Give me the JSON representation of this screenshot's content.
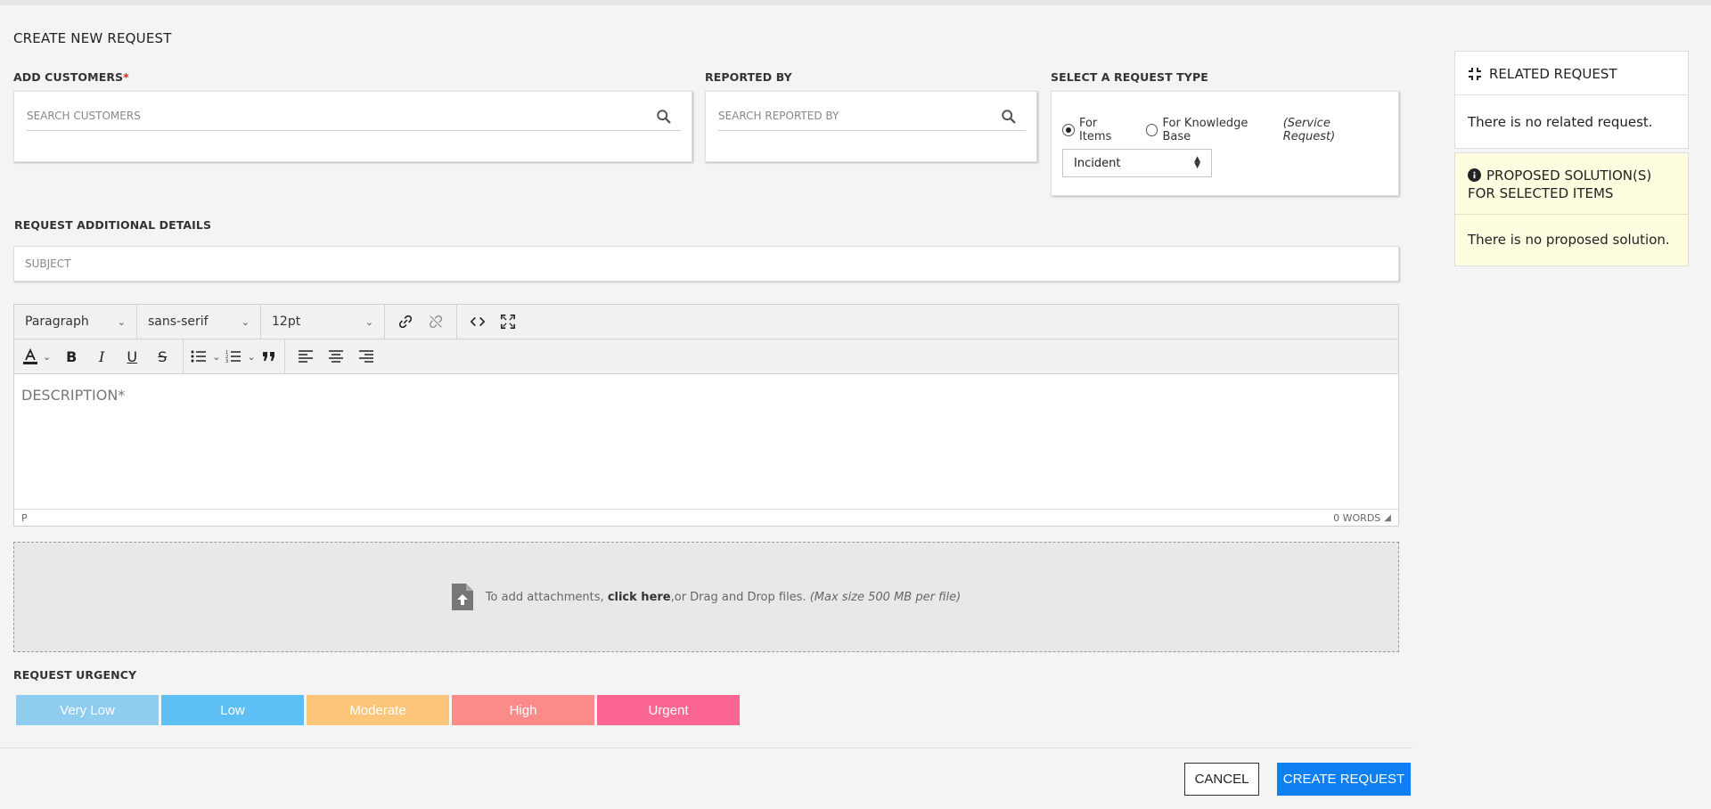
{
  "page": {
    "title": "CREATE NEW REQUEST"
  },
  "customers": {
    "label": "ADD CUSTOMERS",
    "required_mark": "*",
    "placeholder": "SEARCH CUSTOMERS"
  },
  "reported_by": {
    "label": "REPORTED BY",
    "placeholder": "SEARCH REPORTED BY"
  },
  "request_type": {
    "label": "SELECT A REQUEST TYPE",
    "option_items": "For Items",
    "option_kb": "For Knowledge Base",
    "option_kb_note": "(Service Request)",
    "selected_option": "For Items",
    "type_value": "Incident"
  },
  "details": {
    "label": "REQUEST ADDITIONAL DETAILS",
    "subject_placeholder": "SUBJECT"
  },
  "editor": {
    "block_format": "Paragraph",
    "font_family": "sans-serif",
    "font_size": "12pt",
    "placeholder": "DESCRIPTION*",
    "status_path": "P",
    "word_count": "0 WORDS"
  },
  "attachments": {
    "text_before": "To add attachments, ",
    "click_here": "click here",
    "text_after": ",or Drag and Drop files. ",
    "max_size": "(Max size 500 MB per file)"
  },
  "urgency": {
    "label": "REQUEST URGENCY",
    "levels": [
      {
        "label": "Very Low",
        "color": "#8ecdf0"
      },
      {
        "label": "Low",
        "color": "#5ebff5"
      },
      {
        "label": "Moderate",
        "color": "#fcc67a"
      },
      {
        "label": "High",
        "color": "#fb8b88"
      },
      {
        "label": "Urgent",
        "color": "#fc6692"
      }
    ]
  },
  "actions": {
    "cancel": "CANCEL",
    "create": "CREATE REQUEST"
  },
  "sidebar": {
    "related_title": "RELATED REQUEST",
    "related_text": "There is no related request.",
    "proposed_title_line1": "PROPOSED SOLUTION(S)",
    "proposed_title_line2": "FOR SELECTED ITEMS",
    "proposed_text": "There is no proposed solution."
  },
  "colors": {
    "accent": "#0d7ff0",
    "proposed_bg": "#fffde0"
  }
}
